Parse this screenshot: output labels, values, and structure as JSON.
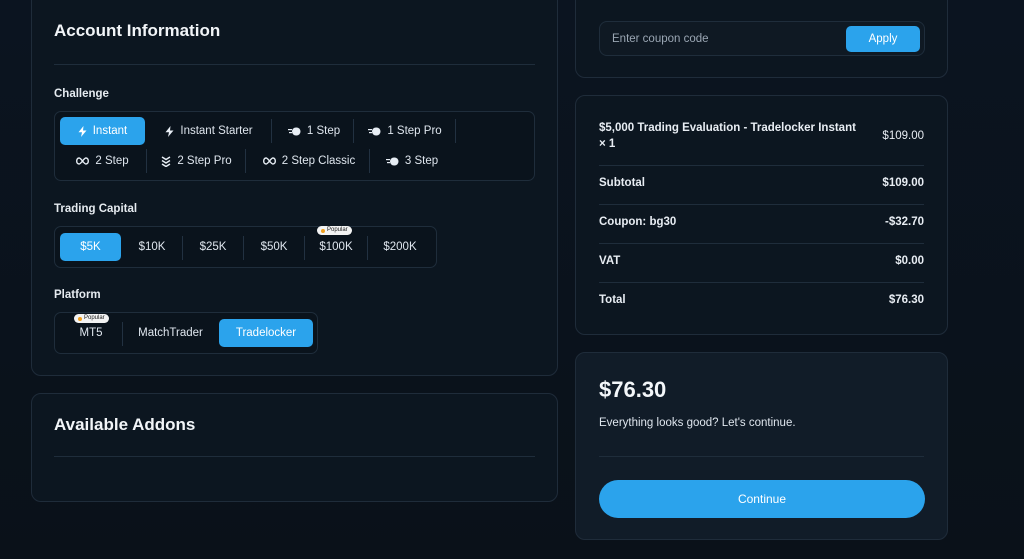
{
  "account": {
    "title": "Account Information",
    "challenge_label": "Challenge",
    "challenge_options": [
      {
        "label": "Instant",
        "icon": "bolt-icon",
        "active": true
      },
      {
        "label": "Instant Starter",
        "icon": "bolt-icon",
        "active": false
      },
      {
        "label": "1 Step",
        "icon": "speed-icon",
        "active": false
      },
      {
        "label": "1 Step Pro",
        "icon": "speed-icon",
        "active": false
      },
      {
        "label": "2 Step",
        "icon": "infinity-icon",
        "active": false
      },
      {
        "label": "2 Step Pro",
        "icon": "stack-icon",
        "active": false
      },
      {
        "label": "2 Step Classic",
        "icon": "infinity-icon",
        "active": false
      },
      {
        "label": "3 Step",
        "icon": "speed-icon",
        "active": false
      }
    ],
    "capital_label": "Trading Capital",
    "capital_options": [
      {
        "label": "$5K",
        "active": true
      },
      {
        "label": "$10K",
        "active": false
      },
      {
        "label": "$25K",
        "active": false
      },
      {
        "label": "$50K",
        "active": false
      },
      {
        "label": "$100K",
        "active": false,
        "badge": "Popular"
      },
      {
        "label": "$200K",
        "active": false
      }
    ],
    "platform_label": "Platform",
    "platform_options": [
      {
        "label": "MT5",
        "active": false,
        "badge": "Popular"
      },
      {
        "label": "MatchTrader",
        "active": false
      },
      {
        "label": "Tradelocker",
        "active": true
      }
    ]
  },
  "addons": {
    "title": "Available Addons"
  },
  "coupon": {
    "placeholder": "Enter coupon code",
    "apply_label": "Apply"
  },
  "summary": {
    "item_label": "$5,000 Trading Evaluation - Tradelocker Instant × 1",
    "item_value": "$109.00",
    "subtotal_label": "Subtotal",
    "subtotal_value": "$109.00",
    "coupon_label": "Coupon: bg30",
    "coupon_value": "-$32.70",
    "vat_label": "VAT",
    "vat_value": "$0.00",
    "total_label": "Total",
    "total_value": "$76.30"
  },
  "checkout": {
    "price": "$76.30",
    "tagline": "Everything looks good? Let's continue.",
    "continue_label": "Continue"
  },
  "colors": {
    "accent": "#2ba3ec",
    "background": "#0a111a",
    "card_border": "#1f2c3a"
  }
}
